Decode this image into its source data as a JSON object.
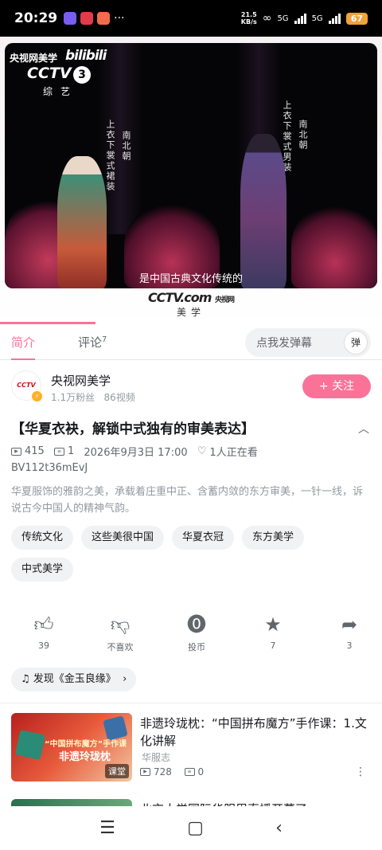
{
  "status_bar": {
    "time": "20:29",
    "net_speed_value": "21.5",
    "net_speed_unit": "KB/s",
    "network1": "5G",
    "network2": "5G",
    "battery": "67"
  },
  "video": {
    "logo_channel": "央视网美学",
    "logo_bili": "bilibili",
    "logo_cctv": "CCTV",
    "logo_cctv_num": "3",
    "logo_zongyi": "综艺",
    "vertical_left_1": "南北朝",
    "vertical_left_2": "上衣下裳式裙装",
    "vertical_right_1": "南北朝",
    "vertical_right_2": "上衣下裳式男装",
    "subtitle": "是中国古典文化传统的",
    "bottom_logo_cctv": "CCTV.com",
    "bottom_logo_sub": "央视网",
    "bottom_logo_name": "美学",
    "progress_fraction": 0.25
  },
  "tabs": {
    "intro": "简介",
    "comments": "评论",
    "comments_count": "7",
    "danmu_placeholder": "点我发弹幕",
    "danmu_button": "弹"
  },
  "uploader": {
    "name": "央视网美学",
    "fans": "1.1万粉丝",
    "videos": "86视频",
    "avatar_text": "CCTV",
    "follow_label": "+ 关注"
  },
  "video_info": {
    "title": "【华夏衣袂，解锁中式独有的审美表达】",
    "plays": "415",
    "danmaku": "1",
    "date": "2026年9月3日 17:00",
    "watching": "1人正在看",
    "bvid": "BV112t36mEvJ",
    "description": "华夏服饰的雅韵之美，承载着庄重中正、含蓄内敛的东方审美，一针一线，诉说古今中国人的精神气韵。"
  },
  "tags": [
    "传统文化",
    "这些美很中国",
    "华夏衣冠",
    "东方美学",
    "中式美学"
  ],
  "actions": {
    "like": "39",
    "dislike": "不喜欢",
    "coin": "投币",
    "favorite": "7",
    "share": "3"
  },
  "music": {
    "label": "发现《金玉良缘》"
  },
  "recommend": {
    "title": "非遗玲珑枕：“中国拼布魔方”手作课：1.文化讲解",
    "uploader": "华服志",
    "plays": "728",
    "danmaku": "0",
    "thumb_line1": "“中国拼布魔方”手作课",
    "thumb_line2": "非遗玲珑枕",
    "thumb_badge": "课堂"
  },
  "recommend2": {
    "title_partial": "北京大学国际华服周直播开幕了"
  },
  "colors": {
    "accent": "#fb7299",
    "text": "#18191c",
    "muted": "#9499a0"
  }
}
